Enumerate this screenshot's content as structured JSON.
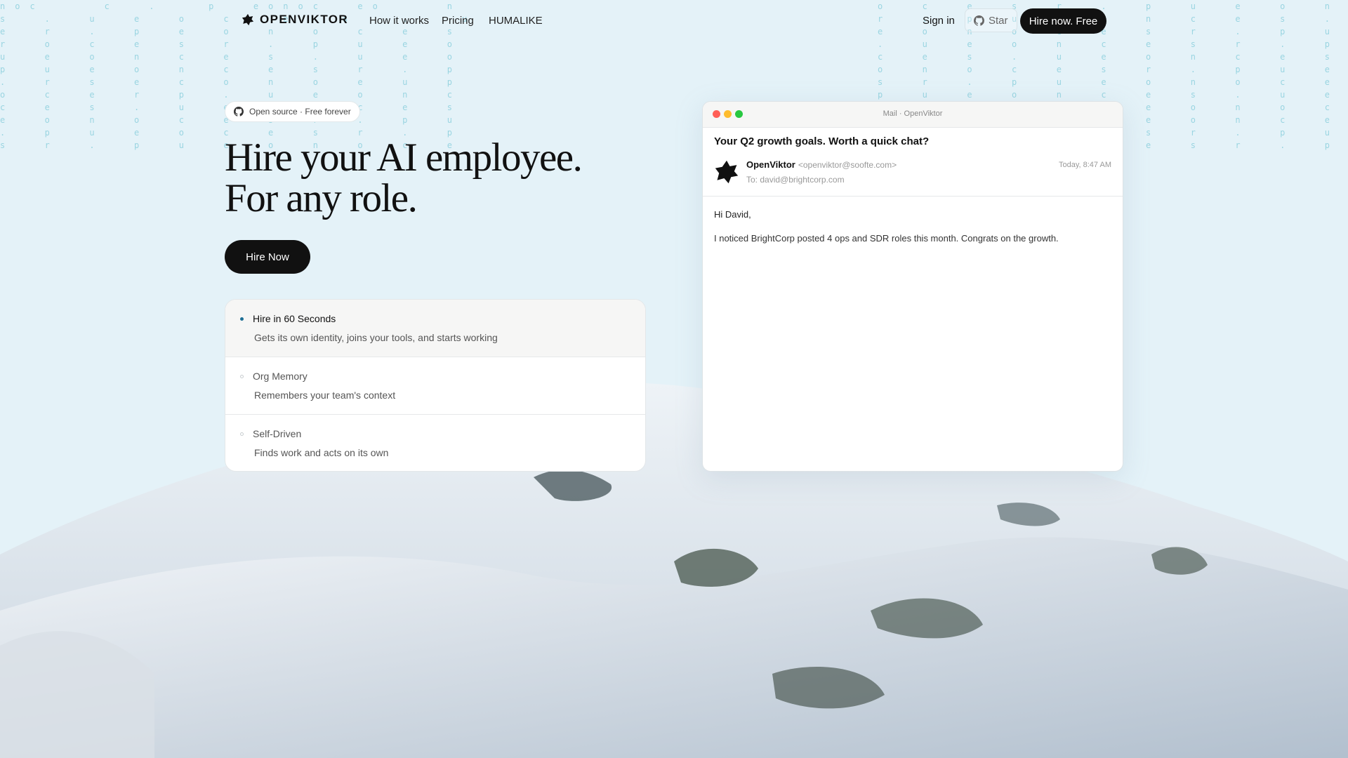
{
  "nav": {
    "brand": "OPENVIKTOR",
    "links": [
      "How it works",
      "Pricing",
      "HUMALIKE"
    ],
    "sign_in": "Sign in",
    "star": "Star",
    "cta": "Hire now. Free"
  },
  "hero": {
    "badge": "Open source · Free forever",
    "headline_line1": "Hire your AI employee.",
    "headline_line2": "For any role.",
    "cta": "Hire Now"
  },
  "features": [
    {
      "title": "Hire in 60 Seconds",
      "description": "Gets its own identity, joins your tools, and starts working",
      "active": true
    },
    {
      "title": "Org Memory",
      "description": "Remembers your team's context",
      "active": false
    },
    {
      "title": "Self-Driven",
      "description": "Finds work and acts on its own",
      "active": false
    }
  ],
  "mail": {
    "window_title": "Mail · OpenViktor",
    "subject": "Your Q2 growth goals. Worth a quick chat?",
    "sender_name": "OpenViktor",
    "sender_email": "<openviktor@soofte.com>",
    "to": "To: david@brightcorp.com",
    "timestamp": "Today, 8:47 AM",
    "greeting": "Hi David,",
    "body": "I noticed BrightCorp posted 4 ops and SDR roles this month. Congrats on the growth."
  },
  "colors": {
    "page_background": "#e4f2f8",
    "button_dark": "#111111",
    "active_dot": "#1e6f95",
    "traffic_red": "#ff5f57",
    "traffic_yellow": "#febc2e",
    "traffic_green": "#28c840"
  },
  "icons": {
    "logo": "viktor-blob-icon",
    "github": "github-icon"
  }
}
